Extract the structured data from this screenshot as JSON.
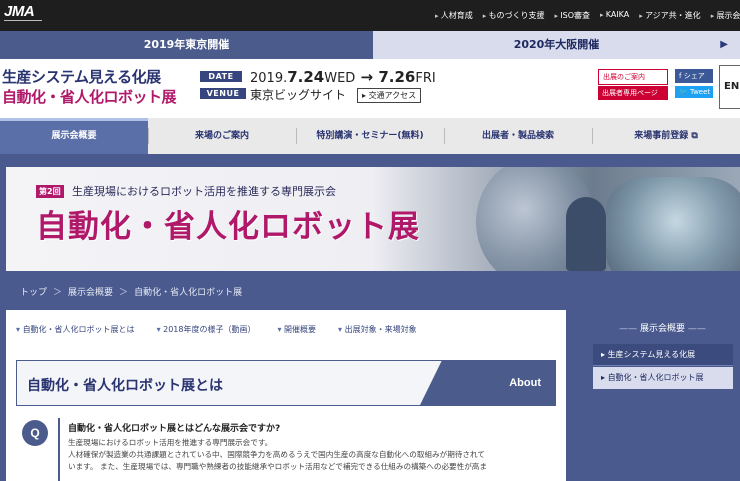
{
  "topbar": {
    "logo": "JMA",
    "nav": [
      "人材育成",
      "ものづくり支援",
      "ISO審査",
      "KAIKA",
      "アジア共・進化",
      "展示会"
    ]
  },
  "year_tabs": {
    "current": "2019年東京開催",
    "next": "2020年大阪開催"
  },
  "header": {
    "title_line1": "生産システム見える化展",
    "title_line2": "自動化・省人化ロボット展",
    "date_label": "DATE",
    "date_prefix": "2019.",
    "date_start": "7.24",
    "date_start_day": "WED",
    "date_arrow": " → ",
    "date_end": "7.26",
    "date_end_day": "FRI",
    "venue_label": "VENUE",
    "venue": "東京ビッグサイト",
    "access": "交通アクセス",
    "invite_button": "出展のご案内",
    "exhibitor_button": "出展者専用ページ",
    "share_button": "シェア",
    "tweet_button": "Tweet",
    "lang_button": "EN"
  },
  "main_nav": [
    "展示会概要",
    "来場のご案内",
    "特別講演・セミナー(無料)",
    "出展者・製品検索",
    "来場事前登録"
  ],
  "hero": {
    "badge": "第2回",
    "subtitle": "生産現場におけるロボット活用を推進する専門展示会",
    "title": "自動化・省人化ロボット展"
  },
  "breadcrumb": [
    "トップ",
    "展示会概要",
    "自動化・省人化ロボット展"
  ],
  "content": {
    "anchors": [
      "自動化・省人化ロボット展とは",
      "2018年度の様子（動画）",
      "開催概要",
      "出展対象・来場対象"
    ],
    "section_title": "自動化・省人化ロボット展とは",
    "section_tag": "About",
    "q_icon": "Q",
    "q_title": "自動化・省人化ロボット展とはどんな展示会ですか?",
    "q_body": [
      "生産現場におけるロボット活用を推進する専門展示会です。",
      "人材確保が製造業の共通課題とされている中、国際競争力を高めるうえで国内生産の高度な自動化への取組みが期待されて",
      "います。 また、生産現場では、専門職や熟練者の技能継承やロボット活用などで補完できる仕組みの構築への必要性が高ま"
    ]
  },
  "sidebar": {
    "heading": "展示会概要",
    "items": [
      "生産システム見える化展",
      "自動化・省人化ロボット展"
    ]
  }
}
